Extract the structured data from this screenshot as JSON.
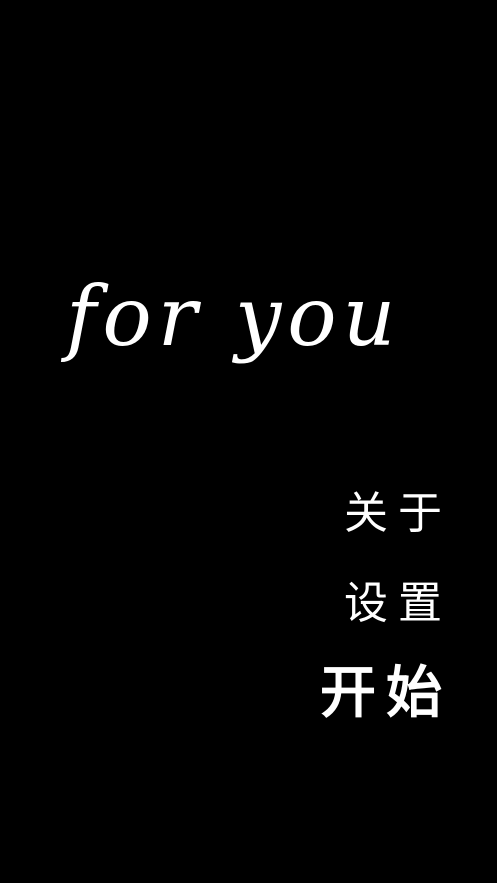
{
  "screen": {
    "title": "for you",
    "background_color": "#000000",
    "text_color": "#ffffff"
  },
  "menu": {
    "about_label": "关于",
    "settings_label": "设置",
    "start_label": "开始"
  }
}
